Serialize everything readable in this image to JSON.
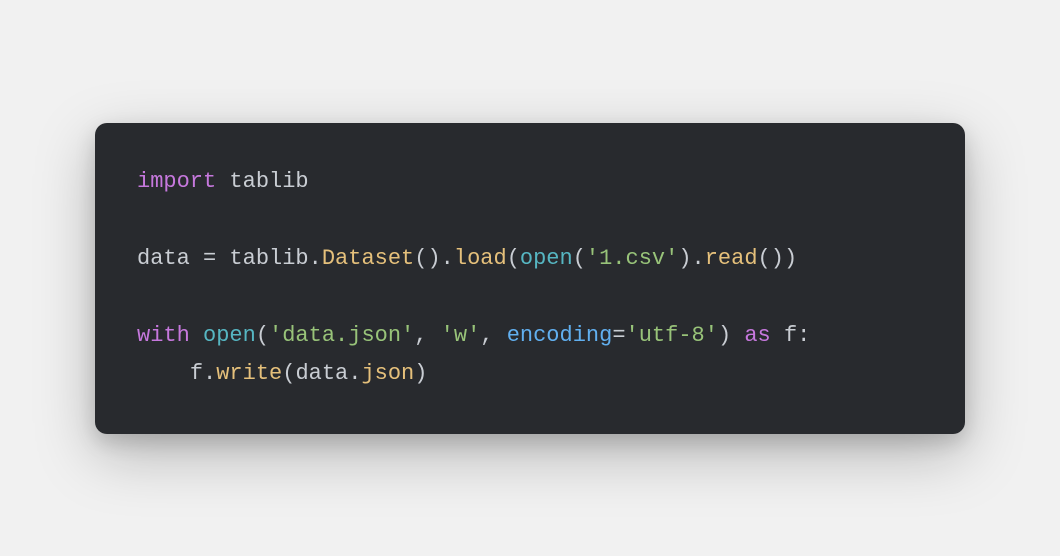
{
  "code": {
    "language": "python",
    "lines": [
      {
        "tokens": [
          {
            "type": "keyword",
            "text": "import"
          },
          {
            "type": "space",
            "text": " "
          },
          {
            "type": "name",
            "text": "tablib"
          }
        ]
      },
      {
        "tokens": []
      },
      {
        "tokens": [
          {
            "type": "name",
            "text": "data"
          },
          {
            "type": "space",
            "text": " "
          },
          {
            "type": "op",
            "text": "="
          },
          {
            "type": "space",
            "text": " "
          },
          {
            "type": "name",
            "text": "tablib"
          },
          {
            "type": "punct",
            "text": "."
          },
          {
            "type": "func",
            "text": "Dataset"
          },
          {
            "type": "punct",
            "text": "()."
          },
          {
            "type": "func",
            "text": "load"
          },
          {
            "type": "punct",
            "text": "("
          },
          {
            "type": "builtin",
            "text": "open"
          },
          {
            "type": "punct",
            "text": "("
          },
          {
            "type": "string",
            "text": "'1.csv'"
          },
          {
            "type": "punct",
            "text": ")."
          },
          {
            "type": "func",
            "text": "read"
          },
          {
            "type": "punct",
            "text": "())"
          }
        ]
      },
      {
        "tokens": []
      },
      {
        "tokens": [
          {
            "type": "keyword",
            "text": "with"
          },
          {
            "type": "space",
            "text": " "
          },
          {
            "type": "builtin",
            "text": "open"
          },
          {
            "type": "punct",
            "text": "("
          },
          {
            "type": "string",
            "text": "'data.json'"
          },
          {
            "type": "punct",
            "text": ", "
          },
          {
            "type": "string",
            "text": "'w'"
          },
          {
            "type": "punct",
            "text": ", "
          },
          {
            "type": "param",
            "text": "encoding"
          },
          {
            "type": "op",
            "text": "="
          },
          {
            "type": "string",
            "text": "'utf-8'"
          },
          {
            "type": "punct",
            "text": ")"
          },
          {
            "type": "space",
            "text": " "
          },
          {
            "type": "keyword",
            "text": "as"
          },
          {
            "type": "space",
            "text": " "
          },
          {
            "type": "name",
            "text": "f"
          },
          {
            "type": "punct",
            "text": ":"
          }
        ]
      },
      {
        "tokens": [
          {
            "type": "space",
            "text": "    "
          },
          {
            "type": "name",
            "text": "f"
          },
          {
            "type": "punct",
            "text": "."
          },
          {
            "type": "func",
            "text": "write"
          },
          {
            "type": "punct",
            "text": "("
          },
          {
            "type": "name",
            "text": "data"
          },
          {
            "type": "punct",
            "text": "."
          },
          {
            "type": "attr",
            "text": "json"
          },
          {
            "type": "punct",
            "text": ")"
          }
        ]
      }
    ]
  }
}
